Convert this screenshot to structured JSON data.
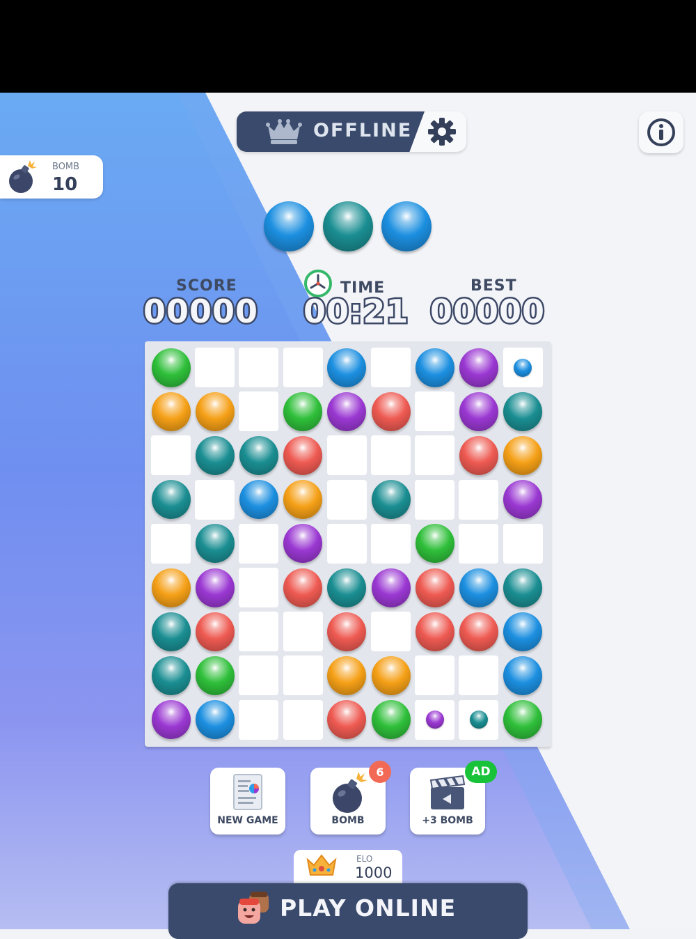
{
  "header": {
    "mode_label": "OFFLINE",
    "icons": [
      "crown-icon",
      "gear-icon",
      "info-icon"
    ]
  },
  "bomb_panel": {
    "label": "BOMB",
    "value": "10"
  },
  "next_balls": [
    "blue",
    "teal",
    "blue"
  ],
  "stats": {
    "score": {
      "label": "SCORE",
      "value": "00000"
    },
    "time": {
      "label": "TIME",
      "value": "00:21"
    },
    "best": {
      "label": "BEST",
      "value": "00000"
    }
  },
  "board": {
    "rows": [
      [
        "G",
        ".",
        ".",
        ".",
        "B",
        ".",
        "B",
        "P",
        "b"
      ],
      [
        "O",
        "O",
        ".",
        "G",
        "P",
        "R",
        ".",
        "P",
        "T"
      ],
      [
        ".",
        "T",
        "T",
        "R",
        ".",
        ".",
        ".",
        "R",
        "O"
      ],
      [
        "T",
        ".",
        "B",
        "O",
        ".",
        "T",
        ".",
        ".",
        "P"
      ],
      [
        ".",
        "T",
        ".",
        "P",
        ".",
        ".",
        "G",
        ".",
        "."
      ],
      [
        "O",
        "P",
        ".",
        "R",
        "T",
        "P",
        "R",
        "B",
        "T"
      ],
      [
        "T",
        "R",
        ".",
        ".",
        "R",
        ".",
        "R",
        "R",
        "B"
      ],
      [
        "T",
        "G",
        ".",
        ".",
        "O",
        "O",
        ".",
        ".",
        "B"
      ],
      [
        "P",
        "B",
        ".",
        ".",
        "R",
        "G",
        "p",
        "t",
        "G"
      ]
    ],
    "legend": {
      "G": "green",
      "B": "blue",
      "P": "purple",
      "O": "orange",
      "R": "red",
      "T": "teal",
      "b": "small blue",
      "p": "small purple",
      "t": "small teal",
      ".": "empty"
    }
  },
  "colors": {
    "green": "#2fbf3a",
    "blue": "#1c8fe0",
    "purple": "#9a38d2",
    "orange": "#f5a017",
    "red": "#ee5a52",
    "teal": "#1a8e92"
  },
  "actions": {
    "new_game": {
      "label": "NEW GAME"
    },
    "bomb": {
      "label": "BOMB",
      "badge": "6"
    },
    "extra_bomb": {
      "label": "+3 BOMB",
      "badge": "AD"
    }
  },
  "elo": {
    "label": "ELO",
    "value": "1000"
  },
  "play_online": {
    "label": "PLAY ONLINE"
  }
}
